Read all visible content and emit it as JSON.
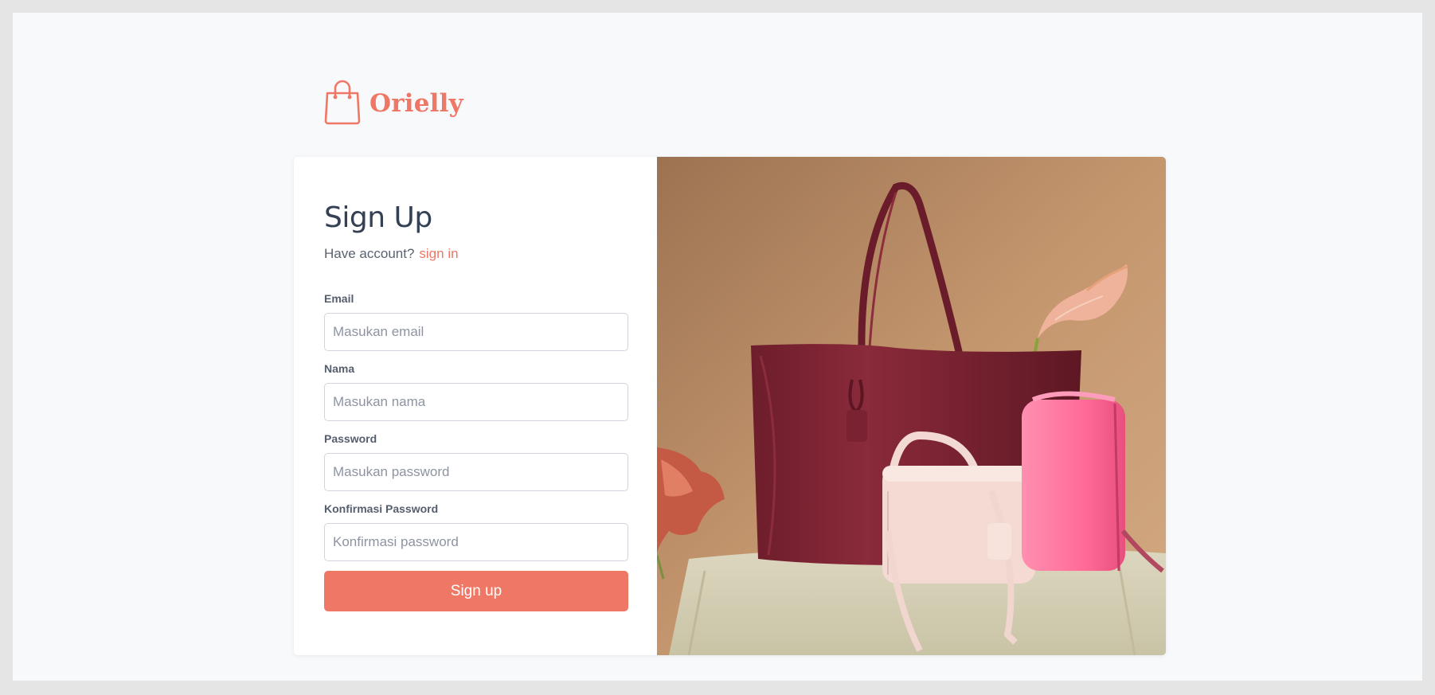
{
  "brand": {
    "name": "Orielly",
    "logo_icon": "shopping-bag-icon",
    "accent_color": "#ef7766"
  },
  "signup": {
    "title": "Sign Up",
    "have_account_text": "Have account?",
    "signin_link": "sign in",
    "fields": [
      {
        "label": "Email",
        "placeholder": "Masukan email",
        "value": ""
      },
      {
        "label": "Nama",
        "placeholder": "Masukan nama",
        "value": ""
      },
      {
        "label": "Password",
        "placeholder": "Masukan password",
        "value": ""
      },
      {
        "label": "Konfirmasi Password",
        "placeholder": "Konfirmasi password",
        "value": ""
      }
    ],
    "submit_label": "Sign up"
  },
  "hero_image": {
    "subject": "product-photo-handbags"
  }
}
